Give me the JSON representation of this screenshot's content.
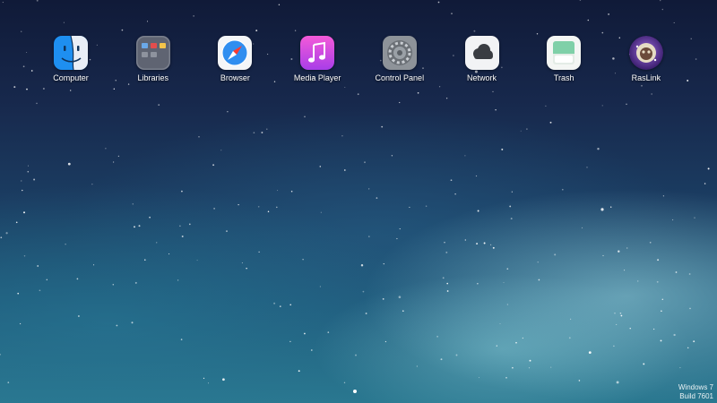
{
  "desktop": {
    "apps": [
      {
        "label": "Computer",
        "icon": "finder-face-icon"
      },
      {
        "label": "Libraries",
        "icon": "folder-grid-icon"
      },
      {
        "label": "Browser",
        "icon": "compass-icon"
      },
      {
        "label": "Media Player",
        "icon": "music-note-icon"
      },
      {
        "label": "Control Panel",
        "icon": "gear-icon"
      },
      {
        "label": "Network",
        "icon": "cloud-icon"
      },
      {
        "label": "Trash",
        "icon": "trash-bin-icon"
      },
      {
        "label": "RasLink",
        "icon": "raspberry-icon"
      }
    ],
    "page_indicator": {
      "current": 1,
      "total": 1
    }
  },
  "watermark": {
    "line1": "Windows 7",
    "line2": "Build 7601"
  },
  "colors": {
    "wallpaper_top": "#101a38",
    "wallpaper_bottom": "#2a7890",
    "label": "#ffffff"
  }
}
